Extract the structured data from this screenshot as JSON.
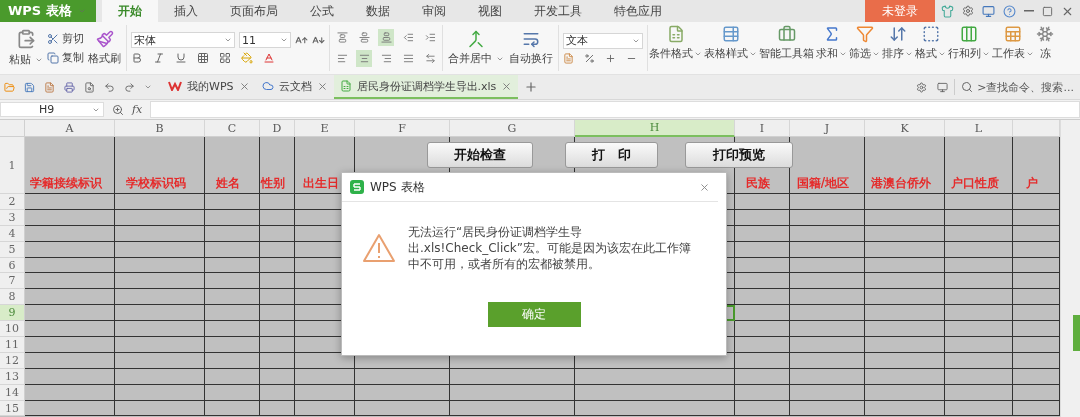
{
  "app": {
    "name": "WPS 表格"
  },
  "menu_tabs": [
    {
      "label": "开始",
      "selected": true
    },
    {
      "label": "插入",
      "selected": false
    },
    {
      "label": "页面布局",
      "selected": false
    },
    {
      "label": "公式",
      "selected": false
    },
    {
      "label": "数据",
      "selected": false
    },
    {
      "label": "审阅",
      "selected": false
    },
    {
      "label": "视图",
      "selected": false
    },
    {
      "label": "开发工具",
      "selected": false
    },
    {
      "label": "特色应用",
      "selected": false
    }
  ],
  "login": "未登录",
  "clipboard": {
    "paste": "粘贴",
    "cut": "剪切",
    "copy": "复制",
    "format_painter": "格式刷"
  },
  "font": {
    "family": "宋体",
    "size": "11"
  },
  "align_buttons": [
    {
      "selected": false
    },
    {
      "selected": false
    },
    {
      "selected": true
    },
    {
      "selected": false
    },
    {
      "selected": false
    },
    {
      "selected": false
    },
    {
      "selected": true
    },
    {
      "selected": false
    },
    {
      "selected": false
    },
    {
      "selected": false
    }
  ],
  "merge_buttons": [
    {
      "label": "合并居中",
      "dropdown": true
    },
    {
      "label": "自动换行",
      "dropdown": false
    }
  ],
  "number_format": "文本",
  "tool_buttons": [
    {
      "label": "条件格式",
      "dropdown": true
    },
    {
      "label": "表格样式",
      "dropdown": true
    },
    {
      "label": "智能工具箱",
      "dropdown": false
    },
    {
      "label": "求和",
      "dropdown": true
    },
    {
      "label": "筛选",
      "dropdown": true
    },
    {
      "label": "排序",
      "dropdown": true
    },
    {
      "label": "格式",
      "dropdown": true
    },
    {
      "label": "行和列",
      "dropdown": true
    },
    {
      "label": "工作表",
      "dropdown": true
    },
    {
      "label": "冻",
      "dropdown": false
    }
  ],
  "doc_tabs": [
    {
      "label": "我的WPS",
      "selected": false
    },
    {
      "label": "云文档",
      "selected": false
    },
    {
      "label": "居民身份证调档学生导出.xls",
      "selected": true
    }
  ],
  "search": {
    "placeholder": ">查找命令、搜索..."
  },
  "formula_bar": {
    "name_box": "H9",
    "fx": "fx"
  },
  "columns": [
    {
      "letter": "A",
      "header": "学籍接续标识",
      "selected": false
    },
    {
      "letter": "B",
      "header": "学校标识码",
      "selected": false
    },
    {
      "letter": "C",
      "header": "姓名",
      "selected": false
    },
    {
      "letter": "D",
      "header": "性别",
      "selected": false
    },
    {
      "letter": "E",
      "header": "出生日",
      "selected": false
    },
    {
      "letter": "F",
      "selected": false
    },
    {
      "letter": "G",
      "selected": false
    },
    {
      "letter": "H",
      "selected": true
    },
    {
      "letter": "I",
      "header": "民族",
      "selected": false
    },
    {
      "letter": "J",
      "header": "国籍/地区",
      "selected": false
    },
    {
      "letter": "K",
      "header": "港澳台侨外",
      "selected": false
    },
    {
      "letter": "L",
      "header": "户口性质",
      "selected": false
    },
    {
      "header": "户",
      "selected": false
    }
  ],
  "rows": [
    {
      "number": "1",
      "selected": false
    },
    {
      "number": "2",
      "selected": false
    },
    {
      "number": "3",
      "selected": false
    },
    {
      "number": "4",
      "selected": false
    },
    {
      "number": "5",
      "selected": false
    },
    {
      "number": "6",
      "selected": false
    },
    {
      "number": "7",
      "selected": false
    },
    {
      "number": "8",
      "selected": false
    },
    {
      "number": "9",
      "selected": true
    },
    {
      "number": "10",
      "selected": false
    },
    {
      "number": "11",
      "selected": false
    },
    {
      "number": "12",
      "selected": false
    },
    {
      "number": "13",
      "selected": false
    },
    {
      "number": "14",
      "selected": false
    },
    {
      "number": "15",
      "selected": false
    }
  ],
  "sheet_buttons": [
    "开始检查",
    "打　印",
    "打印预览"
  ],
  "dialog": {
    "title": "WPS 表格",
    "message": "无法运行“居民身份证调档学生导出.xls!Check_Click”宏。可能是因为该宏在此工作簿中不可用，或者所有的宏都被禁用。",
    "ok": "确定"
  }
}
